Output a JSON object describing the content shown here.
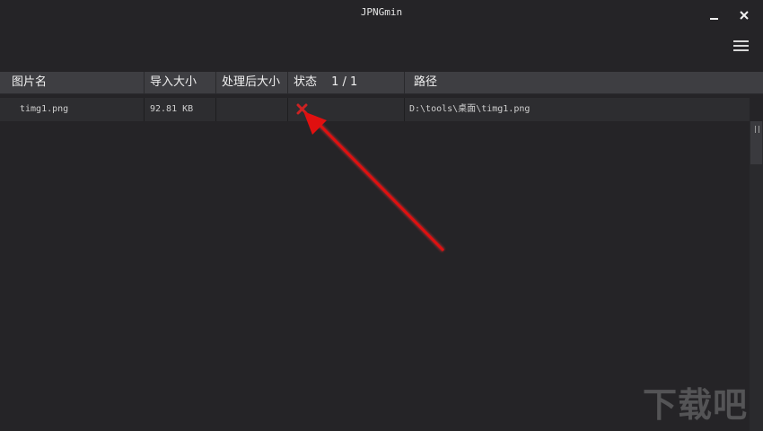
{
  "window": {
    "title": "JPNGmin",
    "min_icon": "minimize-icon",
    "close_icon": "close-icon",
    "menu_icon": "hamburger-menu-icon"
  },
  "table": {
    "headers": {
      "name": "图片名",
      "size": "导入大小",
      "after": "处理后大小",
      "status": "状态",
      "count": "1 / 1",
      "path": "路径"
    },
    "rows": [
      {
        "name": "timg1.png",
        "size": "92.81 KB",
        "after": "",
        "status_icon": "fail-x-icon",
        "path": "D:\\tools\\桌面\\timg1.png"
      }
    ]
  },
  "annotation": {
    "arrow_color": "#e01010"
  },
  "watermark": "下载吧",
  "colors": {
    "background": "#252427",
    "header": "#3e3e42",
    "row": "#2d2d30",
    "fail": "#cc2222"
  }
}
